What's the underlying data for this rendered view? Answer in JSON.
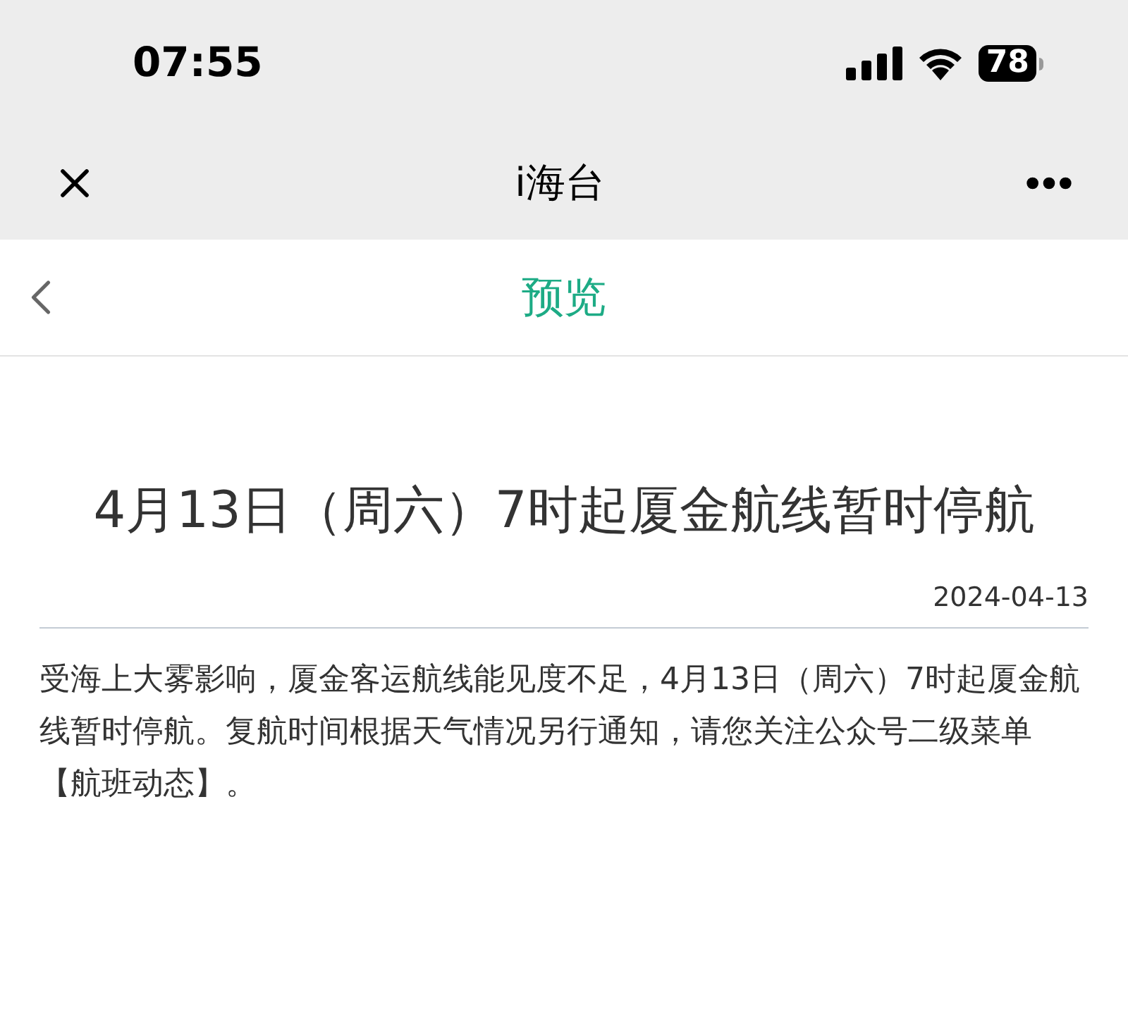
{
  "status_bar": {
    "time": "07:55",
    "battery": "78"
  },
  "title_bar": {
    "title": "i海台"
  },
  "nav": {
    "title": "预览"
  },
  "article": {
    "title": "4月13日（周六）7时起厦金航线暂时停航",
    "date": "2024-04-13",
    "body": "受海上大雾影响，厦金客运航线能见度不足，4月13日（周六）7时起厦金航线暂时停航。复航时间根据天气情况另行通知，请您关注公众号二级菜单【航班动态】。"
  }
}
